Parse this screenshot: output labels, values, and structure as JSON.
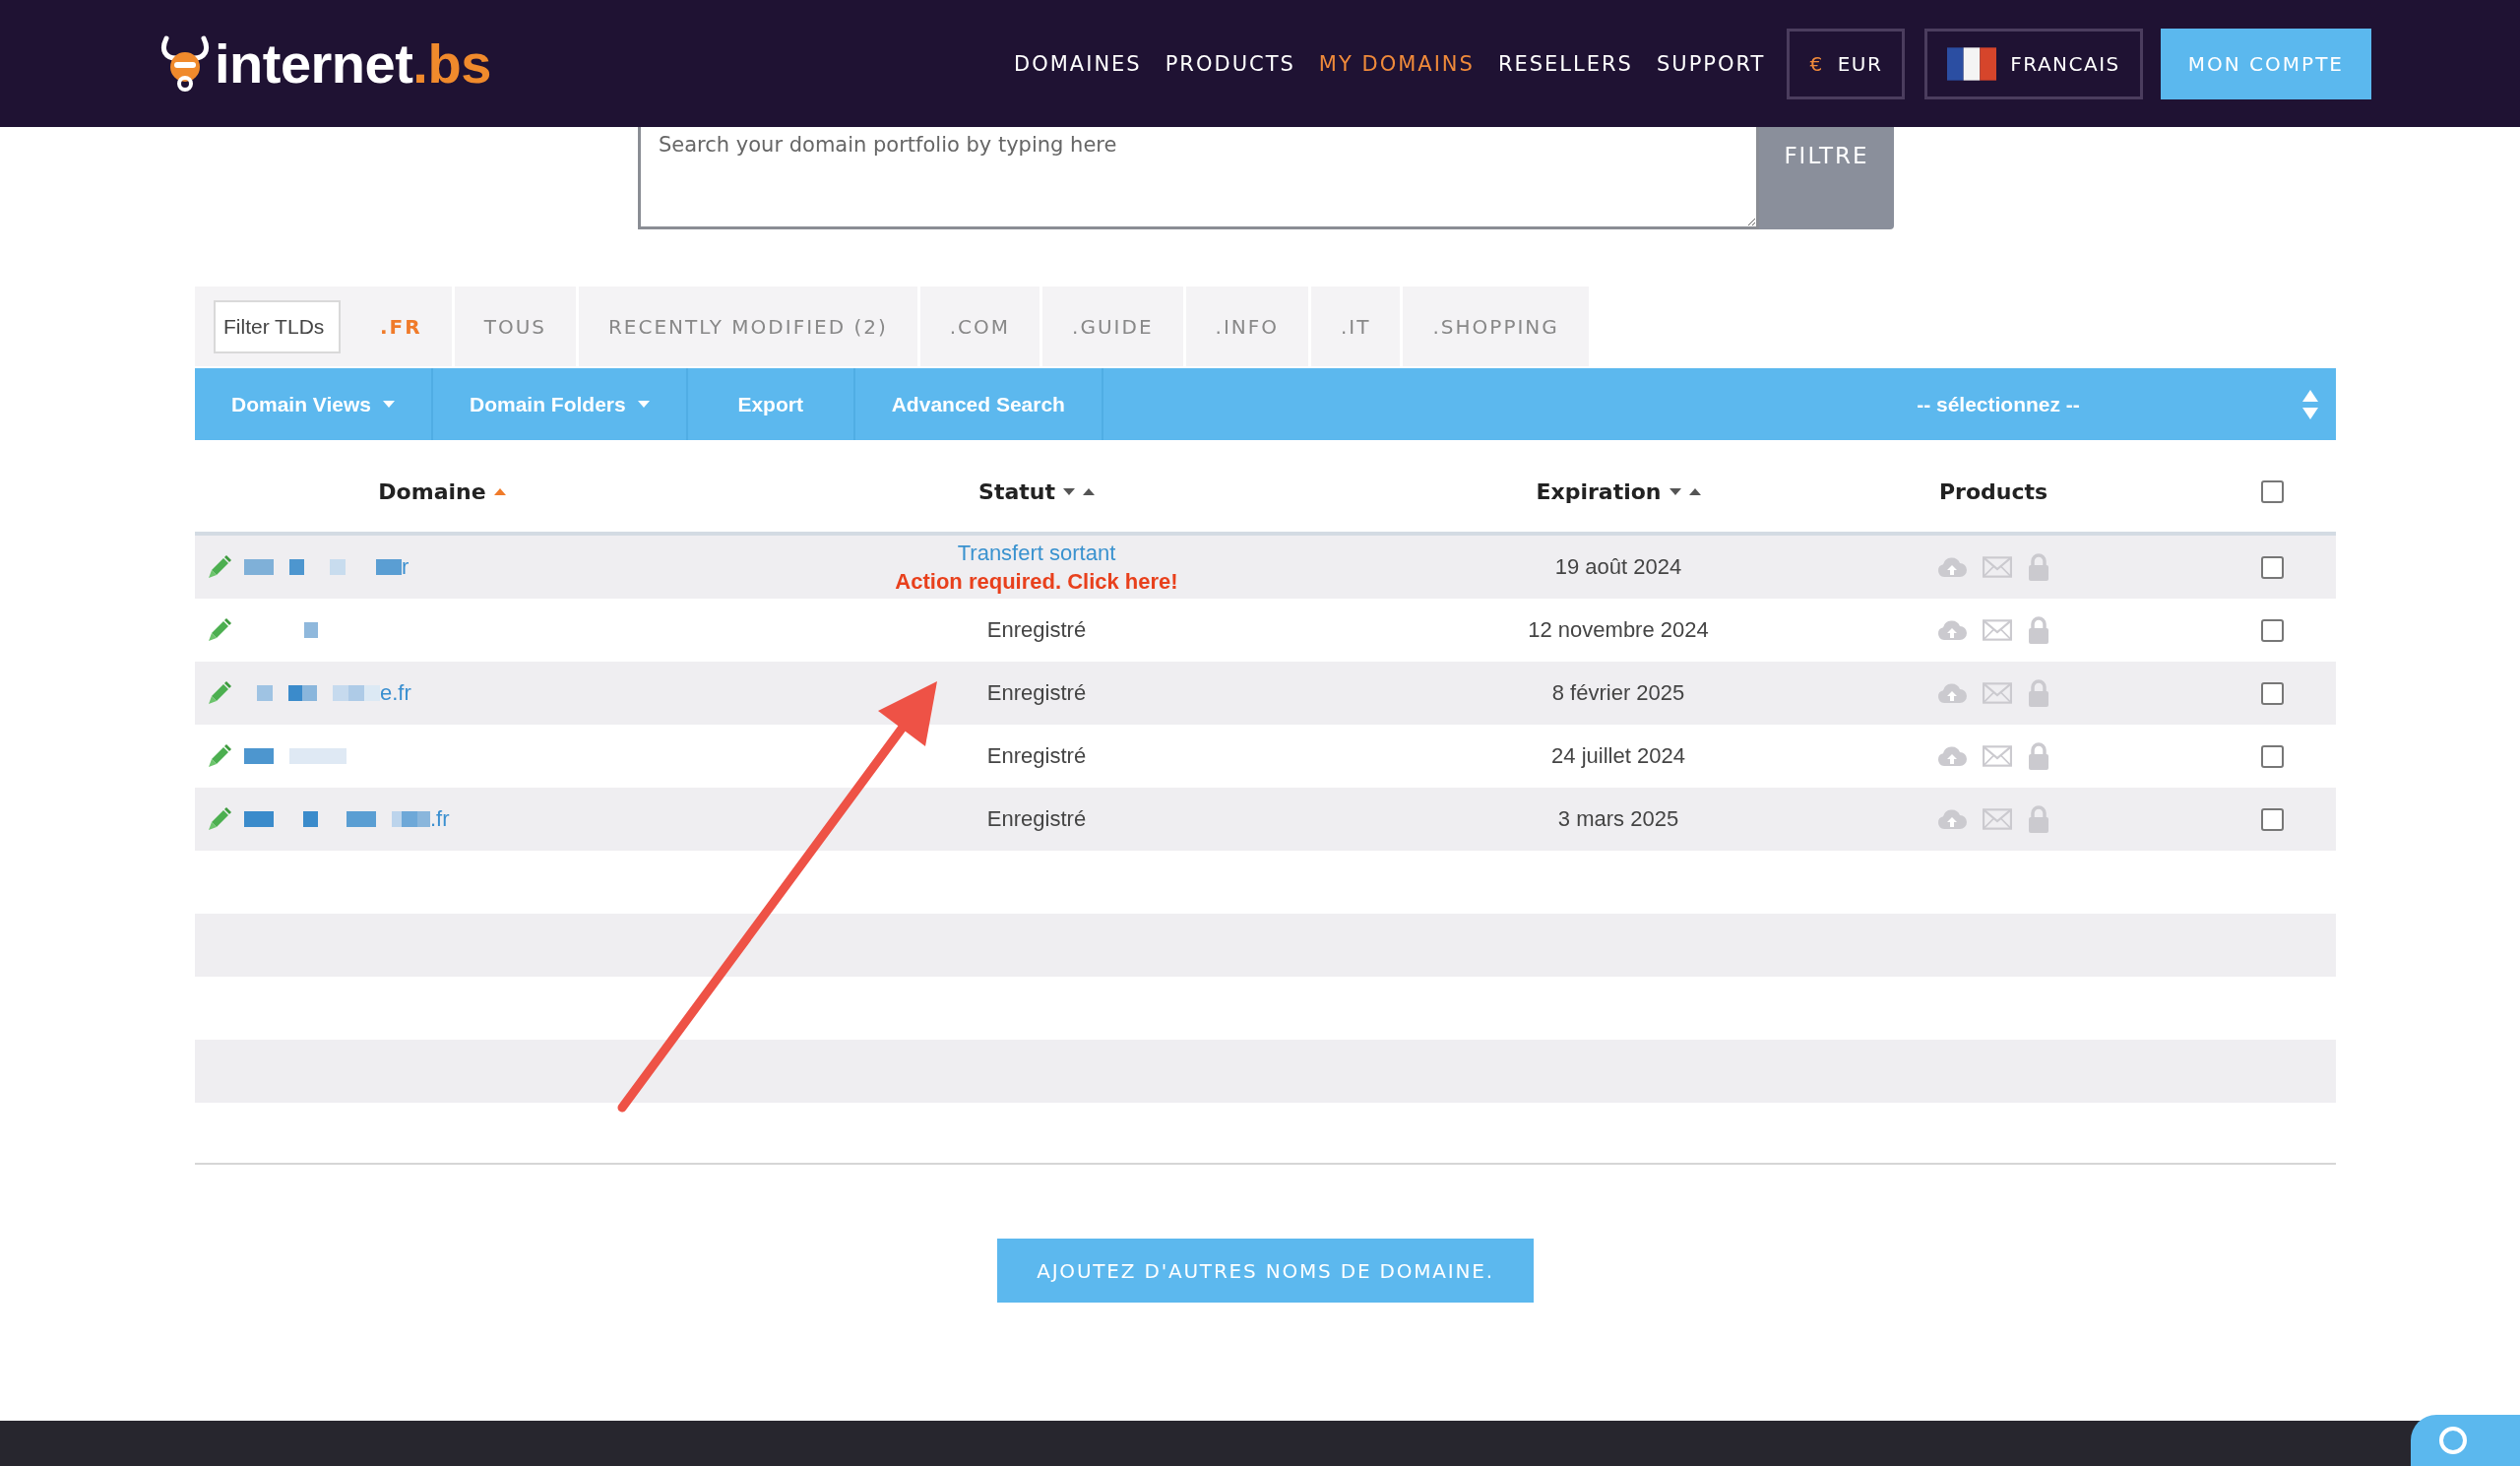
{
  "header": {
    "logo": {
      "name": "internet",
      "suffix": ".bs"
    },
    "nav": [
      {
        "label": "DOMAINES",
        "selected": false
      },
      {
        "label": "PRODUCTS",
        "selected": false
      },
      {
        "label": "MY DOMAINS",
        "selected": true
      },
      {
        "label": "RESELLERS",
        "selected": false
      },
      {
        "label": "SUPPORT",
        "selected": false
      }
    ],
    "currency": {
      "symbol": "€",
      "label": "EUR"
    },
    "language": {
      "label": "FRANCAIS"
    },
    "account_button": "MON COMPTE"
  },
  "search": {
    "placeholder": "Search your domain portfolio by typing here",
    "button": "FILTRE"
  },
  "tld_filter": {
    "placeholder": "Filter TLDs"
  },
  "tabs": [
    {
      "label": ".FR",
      "selected": true
    },
    {
      "label": "TOUS",
      "selected": false
    },
    {
      "label": "RECENTLY MODIFIED (2)",
      "selected": false
    },
    {
      "label": ".COM",
      "selected": false
    },
    {
      "label": ".GUIDE",
      "selected": false
    },
    {
      "label": ".INFO",
      "selected": false
    },
    {
      "label": ".IT",
      "selected": false
    },
    {
      "label": ".SHOPPING",
      "selected": false
    }
  ],
  "toolbar": {
    "items": [
      {
        "label": "Domain Views",
        "kind": "dropdown"
      },
      {
        "label": "Domain Folders",
        "kind": "dropdown"
      },
      {
        "label": "Export",
        "kind": "button"
      },
      {
        "label": "Advanced Search",
        "kind": "button"
      }
    ],
    "select": {
      "value": "-- sélectionnez --"
    }
  },
  "table": {
    "columns": [
      {
        "label": "Domaine",
        "sortable": true,
        "sorted": true
      },
      {
        "label": "Statut",
        "sortable": true,
        "sorted": false
      },
      {
        "label": "Expiration",
        "sortable": true,
        "sorted": false
      },
      {
        "label": "Products"
      }
    ],
    "select_all": {
      "checked": false
    },
    "rows": [
      {
        "domain": "r",
        "redacted": true,
        "status": {
          "text": "Transfert sortant",
          "kind": "link"
        },
        "action": "Action required. Click here!",
        "expiration": "19 août 2024",
        "products": [
          {
            "kind": "cloud",
            "active": false
          },
          {
            "kind": "mail",
            "active": false
          },
          {
            "kind": "lock",
            "active": false
          }
        ],
        "checked": false
      },
      {
        "redacted": true,
        "status": {
          "text": "Enregistré",
          "kind": "plain"
        },
        "expiration": "12 novembre 2024",
        "products": [
          {
            "kind": "cloud",
            "active": false
          },
          {
            "kind": "mail",
            "active": false
          },
          {
            "kind": "lock",
            "active": false
          }
        ],
        "checked": false
      },
      {
        "domain": "e.fr",
        "redacted": true,
        "status": {
          "text": "Enregistré",
          "kind": "plain"
        },
        "expiration": "8 février 2025",
        "products": [
          {
            "kind": "cloud",
            "active": false
          },
          {
            "kind": "mail",
            "active": false
          },
          {
            "kind": "lock",
            "active": false
          }
        ],
        "checked": false
      },
      {
        "redacted": true,
        "status": {
          "text": "Enregistré",
          "kind": "plain"
        },
        "expiration": "24 juillet 2024",
        "products": [
          {
            "kind": "cloud",
            "active": false
          },
          {
            "kind": "mail",
            "active": false
          },
          {
            "kind": "lock",
            "active": false
          }
        ],
        "checked": false
      },
      {
        "domain": ".fr",
        "redacted": true,
        "status": {
          "text": "Enregistré",
          "kind": "plain"
        },
        "expiration": "3 mars 2025",
        "products": [
          {
            "kind": "cloud",
            "active": false
          },
          {
            "kind": "mail",
            "active": false
          },
          {
            "kind": "lock",
            "active": false
          }
        ],
        "checked": false
      }
    ]
  },
  "add_button": "AJOUTEZ D'AUTRES NOMS DE DOMAINE."
}
